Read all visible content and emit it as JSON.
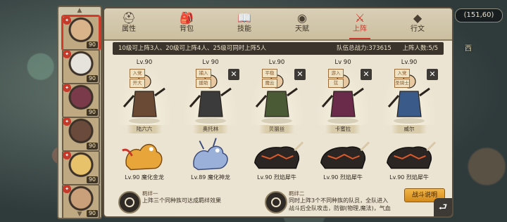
{
  "background": {
    "coord_text": "(151,60)",
    "map_labels": [
      "西"
    ]
  },
  "roster": {
    "heroes": [
      {
        "level": "90",
        "selected": true
      },
      {
        "level": "90"
      },
      {
        "level": "90"
      },
      {
        "level": "90"
      },
      {
        "level": "90"
      },
      {
        "level": "90"
      }
    ]
  },
  "tabs": [
    {
      "label": "属性",
      "icon": "helmet-icon"
    },
    {
      "label": "背包",
      "icon": "bag-icon"
    },
    {
      "label": "技能",
      "icon": "book-icon"
    },
    {
      "label": "天赋",
      "icon": "eye-icon"
    },
    {
      "label": "上阵",
      "icon": "crossed-swords-icon",
      "active": true
    },
    {
      "label": "行文",
      "icon": "gem-icon"
    }
  ],
  "infobar": {
    "rule": "10级可上阵3人、20级可上阵4人、25级可同时上阵5人",
    "power": "队伍总战力:373615",
    "count": "上阵人数:5/5"
  },
  "slots": [
    {
      "level": "Lv.90",
      "tags": [
        "入党",
        "开大"
      ],
      "name": "陆六六",
      "beast": "Lv.90 魔化金龙",
      "close": false
    },
    {
      "level": "Lv 90",
      "tags": [
        "捕入",
        "援助"
      ],
      "name": "奥托林",
      "beast": "Lv.89 魔化神龙",
      "close": true
    },
    {
      "level": "Lv.90",
      "tags": [
        "平稳",
        "魔云"
      ],
      "name": "贝丽丝",
      "beast": "Lv.90 烈焰犀牛",
      "close": true
    },
    {
      "level": "Lv 90",
      "tags": [
        "游入",
        "弦"
      ],
      "name": "卡蜜拉",
      "beast": "Lv.90 烈焰犀牛",
      "close": true
    },
    {
      "level": "Lv.90",
      "tags": [
        "入党",
        "圣骑士"
      ],
      "name": "威尔",
      "beast": "Lv.90 烈焰犀牛",
      "close": true
    }
  ],
  "bonds": [
    {
      "title": "羁绊一",
      "desc": "上阵三个同种族可达成羁绊效果"
    },
    {
      "title": "羁绊二",
      "desc": "同时上阵3个不同种族的队员，全队进入\n战斗后全队攻击，防御(物理,魔法)，气血"
    }
  ],
  "battle_button": "战斗说明",
  "colors": {
    "accent": "#c8372a",
    "panel": "#ece4d2",
    "button": "#e8a231"
  }
}
